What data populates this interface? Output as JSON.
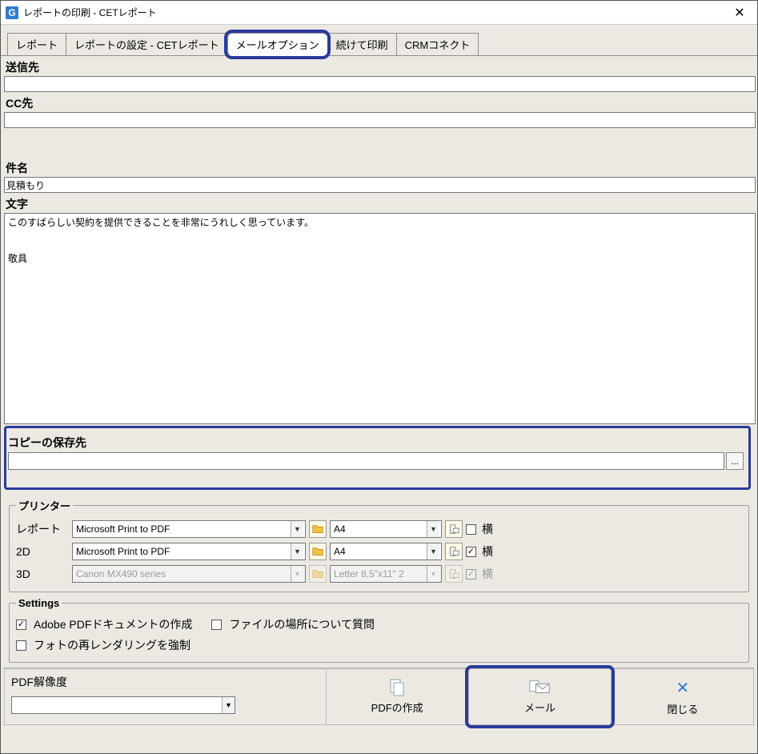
{
  "titlebar": {
    "title": "レポートの印刷 - CETレポート"
  },
  "tabs": [
    {
      "label": "レポート",
      "active": false
    },
    {
      "label": "レポートの設定 - CETレポート",
      "active": false
    },
    {
      "label": "メールオプション",
      "active": true
    },
    {
      "label": "続けて印刷",
      "active": false
    },
    {
      "label": "CRMコネクト",
      "active": false
    }
  ],
  "mail": {
    "to_label": "送信先",
    "to_value": "",
    "cc_label": "CC先",
    "cc_value": "",
    "subject_label": "件名",
    "subject_value": "見積もり",
    "body_label": "文字",
    "body_value": "このすばらしい契約を提供できることを非常にうれしく思っています。\n\n\n敬具"
  },
  "copy": {
    "label": "コピーの保存先",
    "path_value": "",
    "browse_label": "..."
  },
  "printer": {
    "legend": "プリンター",
    "rows": [
      {
        "label": "レポート",
        "printer": "Microsoft Print to PDF",
        "page": "A4",
        "landscape": false,
        "landscape_label": "横",
        "enabled": true
      },
      {
        "label": "2D",
        "printer": "Microsoft Print to PDF",
        "page": "A4",
        "landscape": true,
        "landscape_label": "横",
        "enabled": true
      },
      {
        "label": "3D",
        "printer": "Canon MX490 series",
        "page": "Letter 8.5\"x11\" 2",
        "landscape": true,
        "landscape_label": "横",
        "enabled": false
      }
    ]
  },
  "settings": {
    "legend": "Settings",
    "adobe_pdf": {
      "checked": true,
      "label": "Adobe PDFドキュメントの作成"
    },
    "ask_location": {
      "checked": false,
      "label": "ファイルの場所について質問"
    },
    "force_rerender": {
      "checked": false,
      "label": "フォトの再レンダリングを強制"
    }
  },
  "bottom": {
    "resolution_label": "PDF解像度",
    "resolution_value": "",
    "btn_pdf": "PDFの作成",
    "btn_mail": "メール",
    "btn_close": "閉じる"
  }
}
